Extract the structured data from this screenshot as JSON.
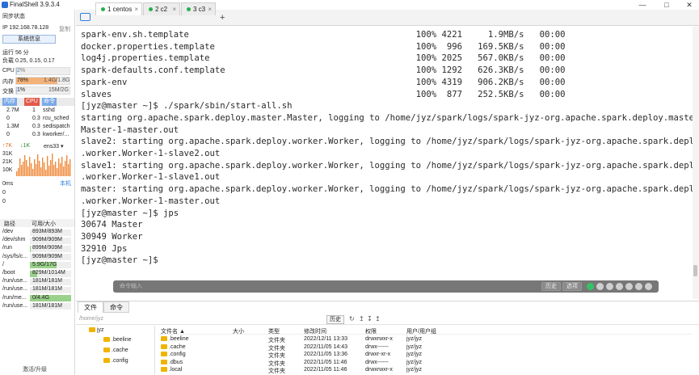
{
  "window": {
    "title": "FinalShell 3.9.3.4",
    "controls": [
      "minimize-icon",
      "maximize-icon",
      "close-icon"
    ]
  },
  "sidebar": {
    "sync_status": "同步状态",
    "ip_label": "IP 192.168.78.128",
    "copy_label": "复制",
    "sysinfo_button": "系统信息",
    "uptime": "运行 56 分",
    "load": "负载 0.25, 0.15, 0.17",
    "cpu": {
      "label": "CPU",
      "value": "2%",
      "percent": 2
    },
    "mem": {
      "label": "内存",
      "percent_text": "78%",
      "value": "1.4G/1.8G",
      "percent": 78
    },
    "swap": {
      "label": "交换",
      "percent_text": "1%",
      "value": "15M/2G",
      "percent": 1
    },
    "proc_tabs": [
      "内存",
      "CPU",
      "命令"
    ],
    "processes": [
      {
        "mem": "2.7M",
        "cpu": "1",
        "cmd": "sshd"
      },
      {
        "mem": "0",
        "cpu": "0.3",
        "cmd": "rcu_sched"
      },
      {
        "mem": "1.3M",
        "cpu": "0.3",
        "cmd": "sedispatch"
      },
      {
        "mem": "0",
        "cpu": "0.3",
        "cmd": "kworker/..."
      }
    ],
    "net": {
      "up": "↑7K",
      "down": "↓1K",
      "iface": "ens33 ▾"
    },
    "net_scale": [
      "31K",
      "21K",
      "10K"
    ],
    "latency_label": "本机",
    "latency_values": [
      "0ms",
      "0",
      "0"
    ],
    "disk_header": {
      "path": "路径",
      "avail": "可用/大小"
    },
    "disks": [
      {
        "path": "/dev",
        "size": "893M/893M",
        "fill": 0
      },
      {
        "path": "/dev/shm",
        "size": "909M/909M",
        "fill": 0
      },
      {
        "path": "/run",
        "size": "899M/909M",
        "fill": 0.01
      },
      {
        "path": "/sys/fs/c...",
        "size": "909M/909M",
        "fill": 0
      },
      {
        "path": "/",
        "size": "5.9G/17G",
        "fill": 0.65
      },
      {
        "path": "/boot",
        "size": "829M/1014M",
        "fill": 0.18
      },
      {
        "path": "/run/use...",
        "size": "181M/181M",
        "fill": 0
      },
      {
        "path": "/run/use...",
        "size": "181M/181M",
        "fill": 0
      },
      {
        "path": "/run/me...",
        "size": "0/4.4G",
        "fill": 1
      },
      {
        "path": "/run/use...",
        "size": "181M/181M",
        "fill": 0
      }
    ],
    "footer": "激活/升级"
  },
  "tabs": [
    {
      "label": "1 centos",
      "active": true
    },
    {
      "label": "2 c2",
      "active": false
    },
    {
      "label": "3 c3",
      "active": false
    }
  ],
  "add_tab": "+",
  "terminal": {
    "lines": [
      "spark-env.sh.template                                            100% 4221     1.9MB/s   00:00",
      "docker.properties.template                                       100%  996   169.5KB/s   00:00",
      "log4j.properties.template                                        100% 2025   567.0KB/s   00:00",
      "spark-defaults.conf.template                                     100% 1292   626.3KB/s   00:00",
      "spark-env                                                        100% 4319   906.2KB/s   00:00",
      "slaves                                                           100%  877   252.5KB/s   00:00",
      "[jyz@master ~]$ ./spark/sbin/start-all.sh",
      "starting org.apache.spark.deploy.master.Master, logging to /home/jyz/spark/logs/spark-jyz-org.apache.spark.deploy.master.",
      "Master-1-master.out",
      "slave2: starting org.apache.spark.deploy.worker.Worker, logging to /home/jyz/spark/logs/spark-jyz-org.apache.spark.deploy",
      ".worker.Worker-1-slave2.out",
      "slave1: starting org.apache.spark.deploy.worker.Worker, logging to /home/jyz/spark/logs/spark-jyz-org.apache.spark.deploy",
      ".worker.Worker-1-slave1.out",
      "master: starting org.apache.spark.deploy.worker.Worker, logging to /home/jyz/spark/logs/spark-jyz-org.apache.spark.deploy",
      ".worker.Worker-1-master.out",
      "[jyz@master ~]$ jps",
      "30674 Master",
      "30949 Worker",
      "32910 Jps",
      "[jyz@master ~]$ "
    ]
  },
  "command_bar": {
    "placeholder": "命令输入",
    "history": "历史",
    "option": "选项"
  },
  "bottom": {
    "tabs": [
      "文件",
      "命令"
    ],
    "path": "/home/jyz",
    "history_btn": "历史",
    "tree": [
      "jyz",
      ".beeline",
      ".cache",
      ".config"
    ],
    "columns": [
      "文件名 ▲",
      "大小",
      "类型",
      "修改时间",
      "权限",
      "用户/用户组"
    ],
    "files": [
      {
        "name": ".beeline",
        "size": "",
        "type": "文件夹",
        "mtime": "2022/12/11 13:33",
        "perm": "drwxrwxr-x",
        "owner": "jyz/jyz"
      },
      {
        "name": ".cache",
        "size": "",
        "type": "文件夹",
        "mtime": "2022/11/05 14:43",
        "perm": "drwx------",
        "owner": "jyz/jyz"
      },
      {
        "name": ".config",
        "size": "",
        "type": "文件夹",
        "mtime": "2022/11/05 13:36",
        "perm": "drwxr-xr-x",
        "owner": "jyz/jyz"
      },
      {
        "name": ".dbus",
        "size": "",
        "type": "文件夹",
        "mtime": "2022/11/05 11:46",
        "perm": "drwx------",
        "owner": "jyz/jyz"
      },
      {
        "name": ".local",
        "size": "",
        "type": "文件夹",
        "mtime": "2022/11/05 11:46",
        "perm": "drwxrwxr-x",
        "owner": "jyz/jyz"
      }
    ]
  },
  "colors": {
    "accent": "#2f7fe0",
    "tab_dot": "#27b14b",
    "mem_bar": "#f3b27a",
    "cpu_tab": "#e25b4b",
    "net_graph": "#f08a3c",
    "disk_bar": "#9ad18b"
  }
}
